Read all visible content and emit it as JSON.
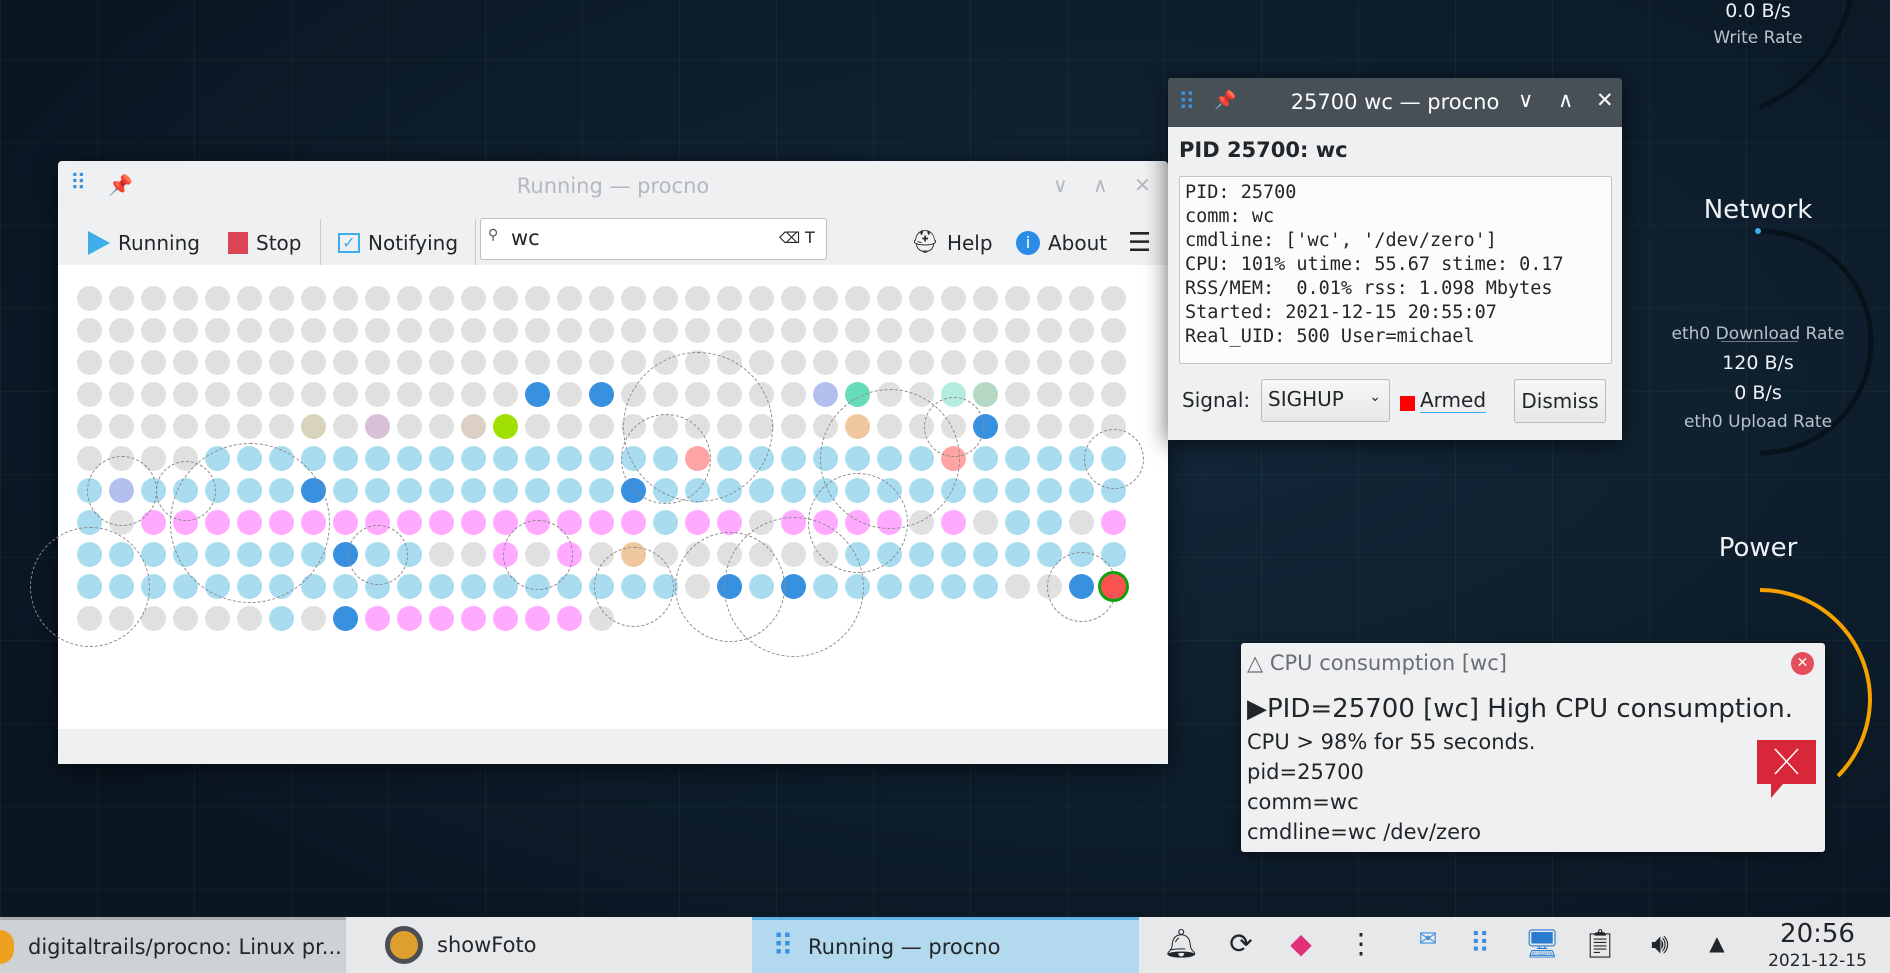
{
  "desktop": {
    "write_rate_value": "0.0 B/s",
    "write_rate_label": "Write Rate",
    "network_title": "Network",
    "download_label": "eth0 Download Rate",
    "download_value": "120 B/s",
    "upload_value": "0 B/s",
    "upload_label": "eth0 Upload Rate",
    "power_title": "Power"
  },
  "main_window": {
    "title": "Running — procno",
    "toolbar": {
      "running": "Running",
      "stop": "Stop",
      "notifying": "Notifying",
      "search_value": "wc",
      "help": "Help",
      "about": "About"
    },
    "grid": {
      "colors": {
        "g": "#e0e0e0",
        "c": "#a8dcee",
        "p": "#ffaaff",
        "b": "#3890e0",
        "v": "#b4bff0",
        "t": "#66dcb8",
        "m": "#b4ece0",
        "s": "#b4d8c4",
        "o": "#f0c8a0",
        "r": "#ffa4a4",
        "y": "#a0e000",
        "k": "#d8d4bc",
        "l": "#d8c0d8",
        "e": "#dcd0c4",
        "R": "#ff5050"
      },
      "highlight_ring_color": "#10a010",
      "rows": [
        "ggggggggggggggggggggggggggggggggg",
        "ggggggggggggggggggggggggggggggggg",
        "ggggggggggggggggggggggggggggggggg",
        "ggggggggggggggbgbggggggvtggmsgggg",
        "gggggggkglggeyggggggggggogggbgggg",
        "ggggcccccccccccccccrcccccccrccccc",
        "cvcccccbcccccccccbccccccccccccccc",
        "cgppppppppppppppppcppgppppgpgccgp",
        "ccccccccbccggpgpgoggggggccccccccc",
        "cccccccccccccccccccgbcbccccccggbR",
        "ggggggcgbpppppppg"
      ]
    }
  },
  "detail_window": {
    "title": "25700 wc — procno",
    "heading": "PID 25700: wc",
    "info_lines": [
      "PID: 25700",
      "comm: wc",
      "cmdline: ['wc', '/dev/zero']",
      "CPU: 101% utime: 55.67 stime: 0.17",
      "RSS/MEM:  0.01% rss: 1.098 Mbytes",
      "Started: 2021-12-15 20:55:07",
      "Real_UID: 500 User=michael"
    ],
    "signal_label": "Signal:",
    "signal_value": "SIGHUP",
    "armed_label": "Armed",
    "armed_color": "#ff0000",
    "dismiss": "Dismiss"
  },
  "notification": {
    "title": "△ CPU consumption [wc]",
    "headline": "▶PID=25700 [wc] High CPU consumption.",
    "lines": [
      "CPU > 98% for 55 seconds.",
      "pid=25700",
      "comm=wc",
      "cmdline=wc /dev/zero"
    ]
  },
  "taskbar": {
    "tasks": [
      "digitaltrails/procno: Linux pr...",
      "showFoto",
      "Running — procno"
    ],
    "clock_time": "20:56",
    "clock_date": "2021-12-15"
  }
}
